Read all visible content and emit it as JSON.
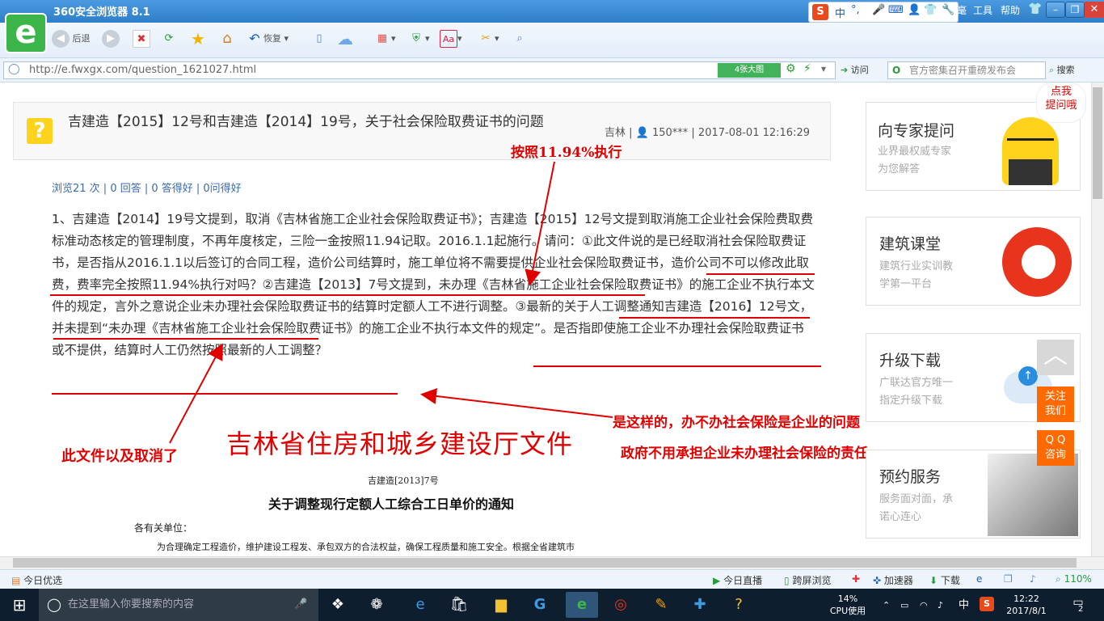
{
  "browser": {
    "title": "360安全浏览器 8.1",
    "menus": [
      "工具",
      "帮助"
    ],
    "ime_label": "中"
  },
  "toolbar": {
    "back": "后退",
    "restore": "恢复"
  },
  "address": {
    "url": "http://e.fwxgx.com/question_1621027.html",
    "big_img": "4张大图",
    "go": "访问",
    "search_placeholder": "官方密集召开重磅发布会",
    "search_btn": "搜索"
  },
  "question": {
    "title": "吉建造【2015】12号和吉建造【2014】19号，关于社会保险取费证书的问题",
    "meta": "吉林 | 👤 150*** | 2017-08-01 12:16:29",
    "stats": "浏览21 次 | 0 回答 | 0 答得好 | 0问得好",
    "body": "1、吉建造【2014】19号文提到，取消《吉林省施工企业社会保险取费证书》；吉建造【2015】12号文提到取消施工企业社会保险费取费标准动态核定的管理制度，不再年度核定，三险一金按照11.94记取。2016.1.1起施行。请问：①此文件说的是已经取消社会保险取费证书，是否指从2016.1.1以后签订的合同工程，造价公司结算时，施工单位将不需要提供企业社会保险取费证书，造价公司不可以修改此取费，费率完全按照11.94%执行对吗？②吉建造【2013】7号文提到，未办理《吉林省施工企业社会保险取费证书》的施工企业不执行本文件的规定，言外之意说企业未办理社会保险取费证书的结算时定额人工不进行调整。③最新的关于人工调整通知吉建造【2016】12号文，并未提到“未办理《吉林省施工企业社会保险取费证书》的施工企业不执行本文件的规定”。是否指即使施工企业不办理社会保险取费证书或不提供，结算时人工仍然按照最新的人工调整？"
  },
  "annotations": {
    "a1": "按照11.94%执行",
    "a2": "是这样的，办不办社会保险是企业的问题",
    "a3": "政府不用承担企业未办理社会保险的责任",
    "a4": "此文件以及取消了"
  },
  "doc": {
    "header": "吉林省住房和城乡建设厅文件",
    "number": "吉建造[2013]7号",
    "title": "关于调整现行定额人工综合工日单价的通知",
    "salutation": "各有关单位：",
    "first_line": "为合理确定工程造价，维护建设工程发、承包双方的合法权益，确保工程质量和施工安全。根据全省建筑市"
  },
  "sidebar": {
    "bubble": "点我\n提问哦",
    "cards": [
      {
        "title": "向专家提问",
        "sub1": "业界最权威专家",
        "sub2": "为您解答"
      },
      {
        "title": "建筑课堂",
        "sub1": "建筑行业实训教",
        "sub2": "学第一平台"
      },
      {
        "title": "升级下载",
        "sub1": "广联达官方唯一",
        "sub2": "指定升级下载"
      },
      {
        "title": "预约服务",
        "sub1": "服务面对面，承",
        "sub2": "诺心连心"
      }
    ],
    "float_follow": "关注\n我们",
    "float_qq": "Q Q\n咨询"
  },
  "statusbar": {
    "left": "今日优选",
    "live": "今日直播",
    "cross": "跨屏浏览",
    "accel": "加速器",
    "download": "下载",
    "zoom": "110%"
  },
  "taskbar": {
    "search": "在这里输入你要搜索的内容",
    "cpu_pct": "14%",
    "cpu_label": "CPU使用",
    "ime": "中",
    "time": "12:22",
    "date": "2017/8/1",
    "notif": "2"
  }
}
